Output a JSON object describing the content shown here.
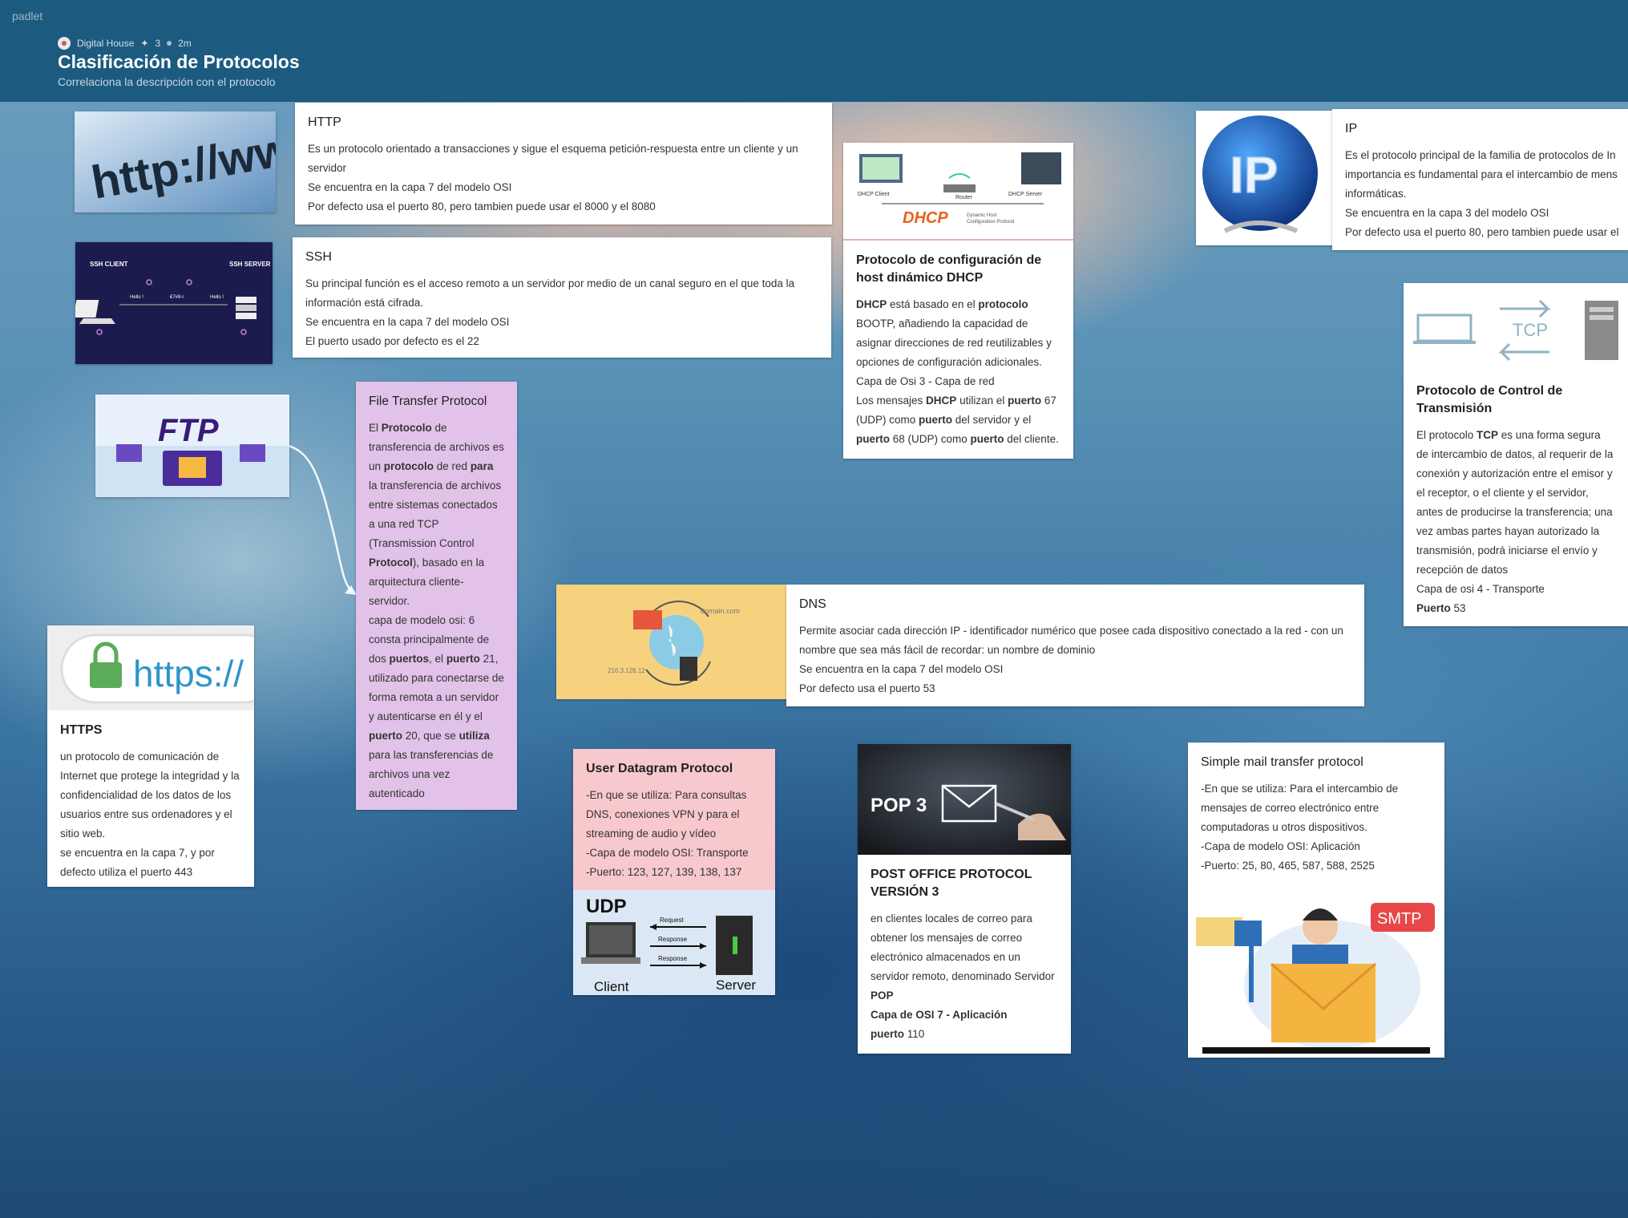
{
  "app": {
    "brand": "padlet"
  },
  "board": {
    "owner": "Digital House",
    "likes": "3",
    "time": "2m",
    "title": "Clasificación de Protocolos",
    "subtitle": "Correlaciona la descripción con el protocolo"
  },
  "colors": {
    "header": "#1d5a80",
    "ftp_card": "#e2c2e8",
    "udp_card": "#f7c8cc",
    "dns_image": "#f7d27e"
  },
  "posts": {
    "http": {
      "title": "HTTP",
      "lines": [
        "Es un protocolo orientado a transacciones y sigue el esquema petición-respuesta entre un cliente y un servidor",
        "Se encuentra en la capa 7 del modelo OSI",
        "Por defecto usa el puerto 80, pero tambien puede usar el 8000 y el 8080"
      ],
      "image_text": "http://ww"
    },
    "ssh": {
      "title": "SSH",
      "lines": [
        "Su principal función es el acceso remoto a un servidor por medio de un canal seguro en el que toda la información está cifrada.",
        "Se encuentra en la capa 7 del modelo OSI",
        "El puerto usado por defecto es el 22"
      ],
      "image_labels": {
        "client": "SSH CLIENT",
        "server": "SSH SERVER",
        "hello1": "Hello !",
        "hello2": "Hello !",
        "mid": "€7#8-r"
      }
    },
    "ftp": {
      "title": "File Transfer Protocol",
      "image_text": "FTP",
      "body": [
        "El ",
        "Protocolo",
        " de transferencia de archivos es un ",
        "protocolo",
        " de red ",
        "para",
        " la transferencia de archivos entre sistemas conectados a una red TCP (Transmission Control ",
        "Protocol",
        "), basado en la arquitectura cliente-servidor.",
        "capa de modelo osi: 6",
        "consta principalmente de dos ",
        "puertos",
        ", el ",
        "puerto",
        " 21, utilizado para conectarse de forma remota a un servidor y autenticarse en él y el ",
        "puerto",
        " 20, que se ",
        "utiliza",
        " para las transferencias de archivos una vez autenticado"
      ]
    },
    "https": {
      "title": "HTTPS",
      "image_text": "https://",
      "lines": [
        "un protocolo de comunicación de Internet que protege la integridad y la confidencialidad de los datos de los usuarios entre sus ordenadores y el sitio web.",
        "se encuentra en la capa 7, y por defecto utiliza el puerto 443"
      ]
    },
    "dhcp": {
      "title": "Protocolo de configuración de host dinámico DHCP",
      "image_labels": {
        "client": "DHCP Client",
        "router": "Router",
        "server": "DHCP Server",
        "logo": "DHCP",
        "logo_sub1": "Dynamic Host",
        "logo_sub2": "Configuration Protocol"
      },
      "body": [
        "DHCP",
        " está basado en el ",
        "protocolo",
        " BOOTP, añadiendo la capacidad de asignar direcciones de red reutilizables y opciones de configuración adicionales.",
        "Capa de Osi 3  - Capa de red",
        "Los mensajes ",
        "DHCP",
        " utilizan el ",
        "puerto",
        " 67 (UDP) como ",
        "puerto",
        " del servidor y el ",
        "puerto",
        " 68 (UDP) como ",
        "puerto",
        " del cliente."
      ]
    },
    "ip": {
      "title": "IP",
      "image_text": "IP",
      "lines": [
        " Es el protocolo principal de la familia de protocolos de In",
        "importancia es fundamental para el intercambio de mens",
        "informáticas.",
        "Se encuentra en la capa 3 del modelo OSI",
        "Por defecto usa el puerto 80, pero tambien puede usar el"
      ]
    },
    "tcp": {
      "title": "Protocolo de Control de Transmisión",
      "image_text": "TCP",
      "body": [
        "El protocolo ",
        "TCP",
        " es una forma segura de intercambio de datos, al requerir de la conexión y autorización entre el emisor y el receptor, o el cliente y el servidor, antes de producirse la transferencia; una vez ambas partes hayan autorizado la transmisión, podrá iniciarse el envío y recepción de datos",
        "Capa de osi 4 - Transporte",
        "Puerto",
        " 53"
      ]
    },
    "dns": {
      "title": "DNS",
      "image_labels": {
        "domain": "domain.com",
        "ip": "216.3.128.12"
      },
      "lines": [
        "Permite asociar cada dirección IP - identificador numérico que posee cada dispositivo conectado a la red - con un nombre que sea más fácil de recordar: un nombre de dominio",
        "Se encuentra en la capa 7 del modelo OSI",
        "Por defecto usa el puerto 53"
      ]
    },
    "udp": {
      "title": "User Datagram Protocol",
      "lines": [
        "-En que se utiliza: Para consultas DNS, conexiones VPN y para el streaming de audio y vídeo",
        "-Capa de modelo OSI: Transporte",
        "-Puerto: 123, 127, 139, 138, 137"
      ],
      "image_labels": {
        "logo": "UDP",
        "request": "Request",
        "response1": "Response",
        "response2": "Response",
        "client": "Client",
        "server": "Server"
      }
    },
    "pop3": {
      "title": "POST OFFICE PROTOCOL VERSIÓN 3",
      "image_text": "POP 3",
      "body": [
        "en clientes locales de correo para obtener los mensajes de correo electrónico almacenados en un servidor remoto, denominado Servidor ",
        "POP",
        "Capa de OSI 7 - Aplicación",
        "puerto",
        " 110"
      ]
    },
    "smtp": {
      "title": "Simple mail transfer protocol",
      "image_text": "SMTP",
      "lines": [
        "-En que se utiliza: Para el intercambio de mensajes de correo electrónico entre computadoras u otros dispositivos.",
        "-Capa de modelo OSI: Aplicación",
        "-Puerto: 25, 80, 465,  587, 588, 2525"
      ]
    }
  },
  "icons": [
    "user-avatar-icon",
    "like-icon",
    "dot-separator-icon",
    "connector-arrow"
  ]
}
